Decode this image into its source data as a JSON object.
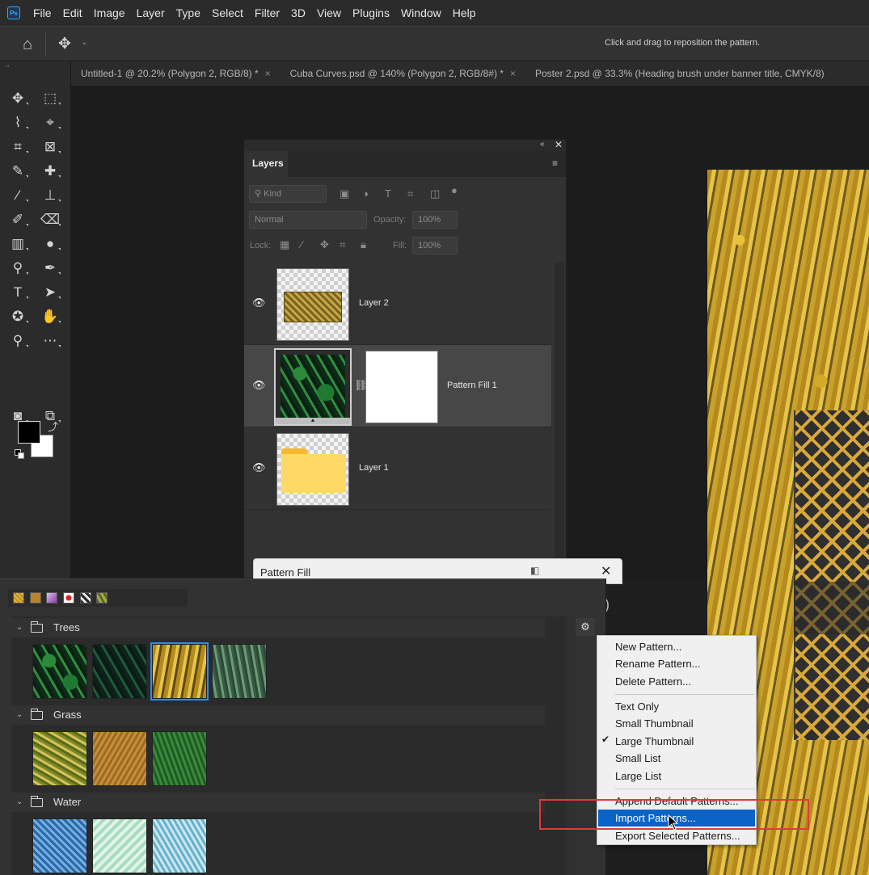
{
  "menubar": {
    "logo": "Ps",
    "items": [
      "File",
      "Edit",
      "Image",
      "Layer",
      "Type",
      "Select",
      "Filter",
      "3D",
      "View",
      "Plugins",
      "Window",
      "Help"
    ]
  },
  "options": {
    "hint": "Click and drag to reposition the pattern."
  },
  "tabs": [
    {
      "label": "Untitled-1 @ 20.2% (Polygon 2, RGB/8) *"
    },
    {
      "label": "Cuba Curves.psd @ 140% (Polygon 2, RGB/8#) *"
    },
    {
      "label": "Poster 2.psd @ 33.3% (Heading brush under banner title, CMYK/8)"
    }
  ],
  "layers_panel": {
    "tab": "Layers",
    "kind_placeholder": "Kind",
    "blend_mode": "Normal",
    "opacity_label": "Opacity:",
    "opacity_value": "100%",
    "lock_label": "Lock:",
    "fill_label": "Fill:",
    "fill_value": "100%",
    "layers": [
      {
        "name": "Layer 2"
      },
      {
        "name": "Pattern Fill 1"
      },
      {
        "name": "Layer 1"
      }
    ]
  },
  "pattern_fill_dialog": {
    "title": "Pattern Fill"
  },
  "pattern_picker": {
    "groups": [
      {
        "name": "Trees",
        "swatch_count": 4,
        "selected_index": 2
      },
      {
        "name": "Grass",
        "swatch_count": 3
      },
      {
        "name": "Water",
        "swatch_count": 3
      }
    ]
  },
  "context_menu": {
    "items": [
      {
        "label": "New Pattern..."
      },
      {
        "label": "Rename Pattern..."
      },
      {
        "label": "Delete Pattern..."
      },
      {
        "label": "Text Only"
      },
      {
        "label": "Small Thumbnail"
      },
      {
        "label": "Large Thumbnail",
        "checked": true
      },
      {
        "label": "Small List"
      },
      {
        "label": "Large List"
      },
      {
        "label": "Append Default Patterns..."
      },
      {
        "label": "Import Patterns...",
        "highlighted": true
      },
      {
        "label": "Export Selected Patterns..."
      }
    ]
  },
  "colors": {
    "accent": "#0a64c8",
    "annotation": "#e03a3a",
    "selection": "#2d8ceb"
  }
}
